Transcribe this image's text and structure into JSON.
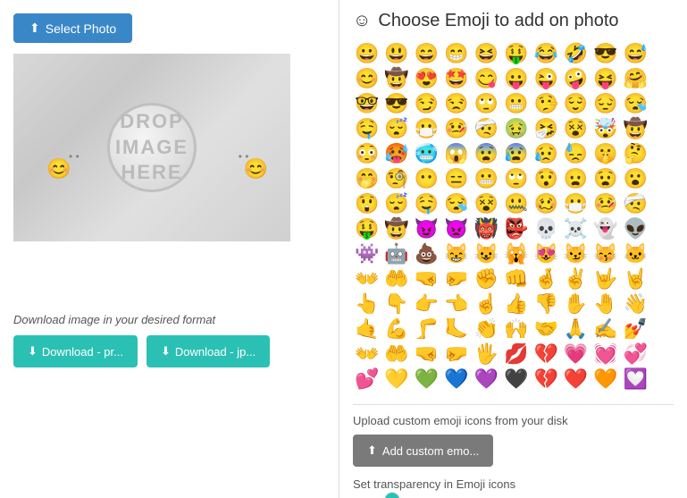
{
  "left": {
    "select_btn": "Select Photo",
    "drop_text": "DROP IMAGE\nHERE",
    "download_label": "Download image in your desired format",
    "download_png_label": "Download - pr...",
    "download_jpg_label": "Download - jp...",
    "emoji_left": "😊",
    "emoji_right": "😊"
  },
  "right": {
    "title": "Choose Emoji to add on photo",
    "title_icon": "☺",
    "emojis": [
      "😀",
      "😃",
      "😄",
      "😁",
      "😆",
      "🤑",
      "😂",
      "🤣",
      "😎",
      "😅",
      "😊",
      "🤠",
      "😍",
      "🤩",
      "😋",
      "😛",
      "😜",
      "🤪",
      "😝",
      "🤗",
      "🤓",
      "😎",
      "😏",
      "😒",
      "🙄",
      "😬",
      "🤥",
      "😌",
      "😔",
      "😪",
      "🤤",
      "😴",
      "😷",
      "🤒",
      "🤕",
      "🤢",
      "🤧",
      "😵",
      "🤯",
      "🤠",
      "😳",
      "🥵",
      "🥶",
      "😱",
      "😨",
      "😰",
      "😥",
      "😓",
      "🤫",
      "🤔",
      "🤭",
      "🧐",
      "😶",
      "😑",
      "😬",
      "🙄",
      "😯",
      "😦",
      "😧",
      "😮",
      "😲",
      "😴",
      "🤤",
      "😪",
      "😵",
      "🤐",
      "🥴",
      "😷",
      "🤒",
      "🤕",
      "🤑",
      "🤠",
      "😈",
      "👿",
      "👹",
      "👺",
      "💀",
      "☠️",
      "👻",
      "👽",
      "👾",
      "🤖",
      "💩",
      "😸",
      "😺",
      "🙀",
      "😻",
      "😼",
      "😽",
      "🐱",
      "👐",
      "🤲",
      "🤜",
      "🤛",
      "✊",
      "👊",
      "🤞",
      "✌️",
      "🤟",
      "🤘",
      "👆",
      "👇",
      "👉",
      "👈",
      "☝️",
      "👍",
      "👎",
      "✋",
      "🤚",
      "👋",
      "🤙",
      "💪",
      "🦵",
      "🦶",
      "👏",
      "🙌",
      "🤝",
      "🙏",
      "✍️",
      "💅",
      "👐",
      "🤲",
      "🤜",
      "🤛",
      "🖐️",
      "💋",
      "💔",
      "💗",
      "💓",
      "💞",
      "💕",
      "💛",
      "💚",
      "💙",
      "💜",
      "🖤",
      "💔",
      "❤️",
      "🧡",
      "💟"
    ],
    "custom_upload_label": "Upload custom emoji icons from your disk",
    "add_custom_btn": "Add custom emo...",
    "transparency_label": "Set transparency in Emoji icons",
    "slider_value": 35
  }
}
